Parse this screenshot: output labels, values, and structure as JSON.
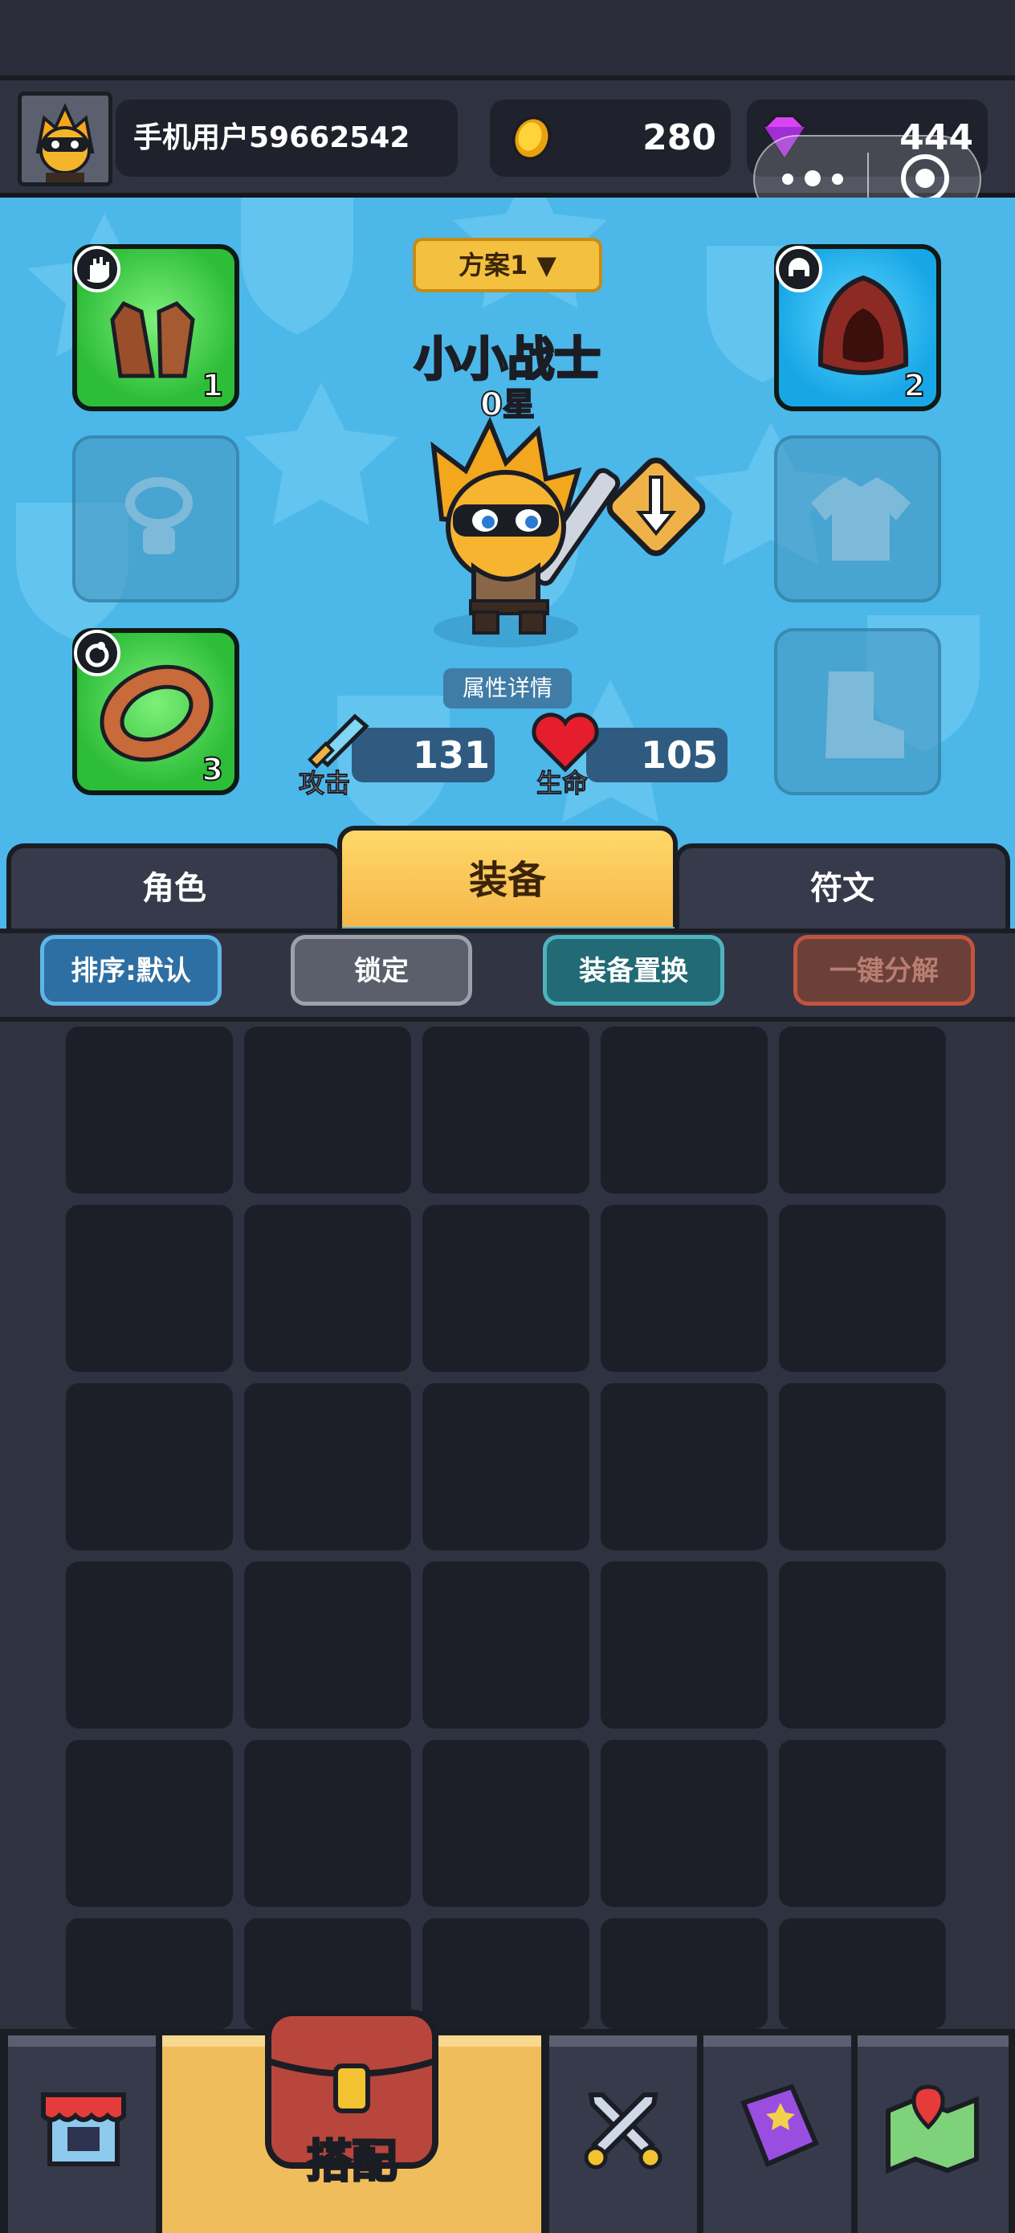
{
  "header": {
    "username": "手机用户59662542",
    "gold": "280",
    "gems": "444"
  },
  "loadout": {
    "plan_label": "方案1 ▼",
    "hero_name": "小小战士",
    "hero_stars": "0星",
    "details_button": "属性详情"
  },
  "stats": {
    "attack_label": "攻击",
    "attack_value": "131",
    "hp_label": "生命",
    "hp_value": "105"
  },
  "equipment_slots": {
    "gloves_count": "1",
    "ring_count": "3",
    "hood_count": "2"
  },
  "tabs": {
    "role": "角色",
    "equipment": "装备",
    "runes": "符文"
  },
  "toolbar": {
    "sort": "排序:默认",
    "lock": "锁定",
    "swap": "装备置换",
    "dismantle": "一键分解"
  },
  "bottom_nav": {
    "loadout_label": "搭配"
  },
  "colors": {
    "accent_gold": "#f6b649",
    "stage_blue": "#4cb7e9",
    "slot_green": "#2dbd39",
    "slot_blue": "#18a7e6",
    "dismantle_red": "#c2543f"
  }
}
